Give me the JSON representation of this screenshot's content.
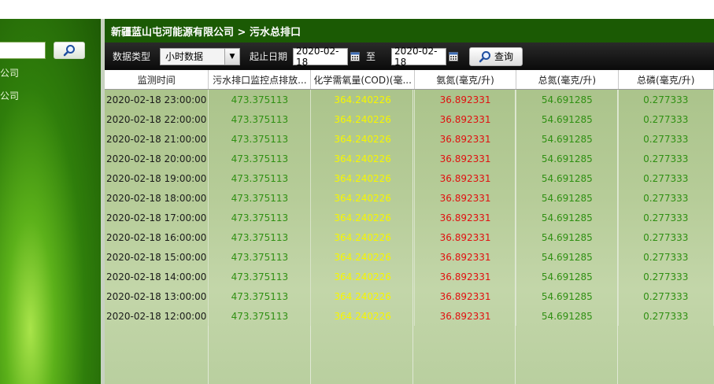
{
  "sidebar": {
    "tree": [
      "公司",
      "公司"
    ]
  },
  "header": {
    "title": "新疆蓝山屯河能源有限公司 > 污水总排口"
  },
  "toolbar": {
    "data_type_label": "数据类型",
    "data_type_value": "小时数据",
    "date_range_label": "起止日期",
    "start_date": "2020-02-18",
    "to_label": "至",
    "end_date": "2020-02-18",
    "query_label": "查询"
  },
  "table": {
    "columns": [
      "监测时间",
      "污水排口监控点排放...",
      "化学需氧量(COD)(毫...",
      "氨氮(毫克/升)",
      "总氮(毫克/升)",
      "总磷(毫克/升)"
    ],
    "rows": [
      [
        "2020-02-18 23:00:00",
        "473.375113",
        "364.240226",
        "36.892331",
        "54.691285",
        "0.277333"
      ],
      [
        "2020-02-18 22:00:00",
        "473.375113",
        "364.240226",
        "36.892331",
        "54.691285",
        "0.277333"
      ],
      [
        "2020-02-18 21:00:00",
        "473.375113",
        "364.240226",
        "36.892331",
        "54.691285",
        "0.277333"
      ],
      [
        "2020-02-18 20:00:00",
        "473.375113",
        "364.240226",
        "36.892331",
        "54.691285",
        "0.277333"
      ],
      [
        "2020-02-18 19:00:00",
        "473.375113",
        "364.240226",
        "36.892331",
        "54.691285",
        "0.277333"
      ],
      [
        "2020-02-18 18:00:00",
        "473.375113",
        "364.240226",
        "36.892331",
        "54.691285",
        "0.277333"
      ],
      [
        "2020-02-18 17:00:00",
        "473.375113",
        "364.240226",
        "36.892331",
        "54.691285",
        "0.277333"
      ],
      [
        "2020-02-18 16:00:00",
        "473.375113",
        "364.240226",
        "36.892331",
        "54.691285",
        "0.277333"
      ],
      [
        "2020-02-18 15:00:00",
        "473.375113",
        "364.240226",
        "36.892331",
        "54.691285",
        "0.277333"
      ],
      [
        "2020-02-18 14:00:00",
        "473.375113",
        "364.240226",
        "36.892331",
        "54.691285",
        "0.277333"
      ],
      [
        "2020-02-18 13:00:00",
        "473.375113",
        "364.240226",
        "36.892331",
        "54.691285",
        "0.277333"
      ],
      [
        "2020-02-18 12:00:00",
        "473.375113",
        "364.240226",
        "36.892331",
        "54.691285",
        "0.277333"
      ]
    ]
  },
  "icons": {
    "search": "search-icon",
    "calendar": "calendar-icon",
    "dropdown": "chevron-down-icon"
  },
  "colors": {
    "title_bar": "#1b5a04",
    "flow": "#2f8f12",
    "cod": "#f6f600",
    "ammonia": "#e01010"
  }
}
